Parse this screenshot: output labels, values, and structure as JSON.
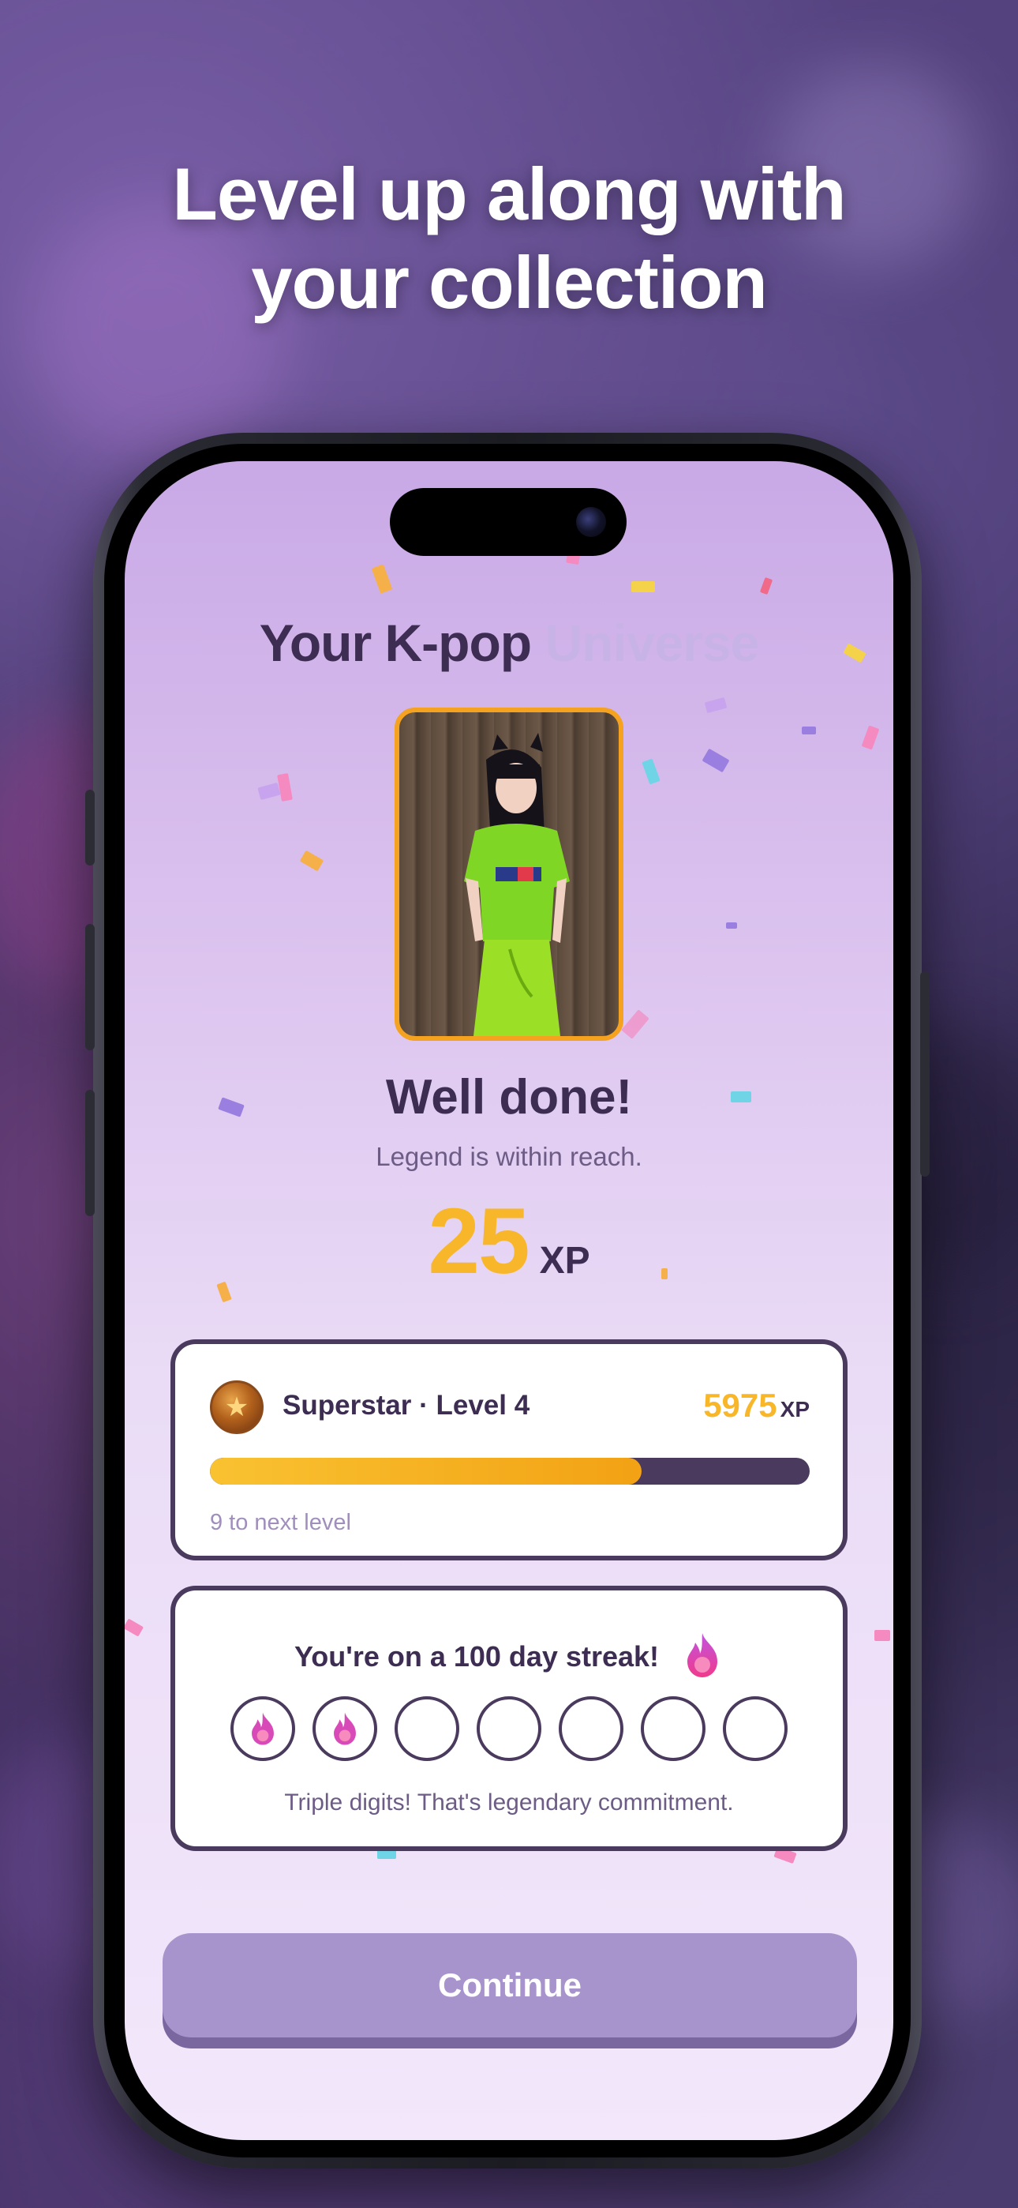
{
  "headline": {
    "line1": "Level up along with",
    "line2": "your collection"
  },
  "app": {
    "title_main": "Your K-pop",
    "title_faded": "Universe"
  },
  "reward": {
    "heading": "Well done!",
    "subheading": "Legend is within reach.",
    "xp_gained": "25",
    "xp_unit": "XP"
  },
  "level": {
    "label": "Superstar · Level 4",
    "xp_total": "5975",
    "xp_unit": "XP",
    "progress_fraction": 0.72,
    "next_level_text": "9 to next level",
    "medal_icon": "star-medal-icon"
  },
  "streak": {
    "title": "You're on a 100 day streak!",
    "days": [
      {
        "state": "done"
      },
      {
        "state": "done"
      },
      {
        "state": "empty"
      },
      {
        "state": "empty"
      },
      {
        "state": "empty"
      },
      {
        "state": "empty"
      },
      {
        "state": "empty"
      }
    ],
    "subtitle": "Triple digits! That's legendary commitment.",
    "icon": "flame-icon"
  },
  "continue_button": {
    "label": "Continue"
  },
  "colors": {
    "accent_gold": "#f8b72a",
    "text_dark": "#3d2d52",
    "button_purple": "#a894cc",
    "flame_pink": "#e83fa0"
  }
}
